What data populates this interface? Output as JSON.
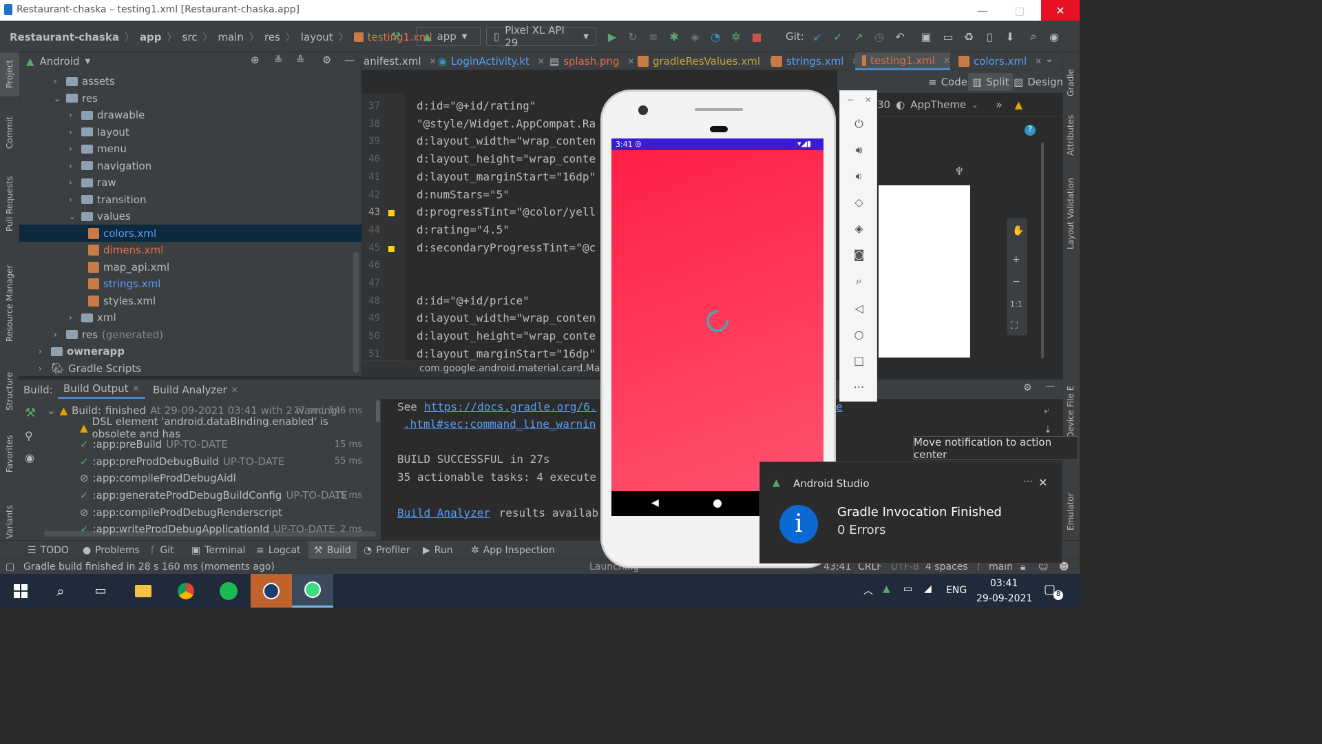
{
  "window": {
    "title": "Restaurant-chaska – testing1.xml [Restaurant-chaska.app]"
  },
  "breadcrumb": [
    "Restaurant-chaska",
    "app",
    "src",
    "main",
    "res",
    "layout",
    "testing1.xml"
  ],
  "toolbar": {
    "config": "app",
    "device": "Pixel XL API 29",
    "git_label": "Git:"
  },
  "project_panel": {
    "title": "Android",
    "items": [
      {
        "label": "assets",
        "depth": 1,
        "type": "folder",
        "expanded": false
      },
      {
        "label": "res",
        "depth": 1,
        "type": "folder",
        "expanded": true
      },
      {
        "label": "drawable",
        "depth": 2,
        "type": "folder",
        "expanded": false
      },
      {
        "label": "layout",
        "depth": 2,
        "type": "folder",
        "expanded": false
      },
      {
        "label": "menu",
        "depth": 2,
        "type": "folder",
        "expanded": false
      },
      {
        "label": "navigation",
        "depth": 2,
        "type": "folder",
        "expanded": false
      },
      {
        "label": "raw",
        "depth": 2,
        "type": "folder",
        "expanded": false
      },
      {
        "label": "transition",
        "depth": 2,
        "type": "folder",
        "expanded": false
      },
      {
        "label": "values",
        "depth": 2,
        "type": "folder",
        "expanded": true
      },
      {
        "label": "colors.xml",
        "depth": 3,
        "type": "xml",
        "selected": true
      },
      {
        "label": "dimens.xml",
        "depth": 3,
        "type": "xml"
      },
      {
        "label": "map_api.xml",
        "depth": 3,
        "type": "xml"
      },
      {
        "label": "strings.xml",
        "depth": 3,
        "type": "xml"
      },
      {
        "label": "styles.xml",
        "depth": 3,
        "type": "xml"
      },
      {
        "label": "xml",
        "depth": 2,
        "type": "folder",
        "expanded": false
      },
      {
        "label": "res",
        "suffix": "(generated)",
        "depth": 1,
        "type": "folder",
        "expanded": false
      },
      {
        "label": "ownerapp",
        "depth": 0,
        "type": "module",
        "expanded": false
      },
      {
        "label": "Gradle Scripts",
        "depth": 0,
        "type": "gradle",
        "expanded": false
      }
    ]
  },
  "editor_tabs": [
    "anifest.xml",
    "LoginActivity.kt",
    "splash.png",
    "gradleResValues.xml",
    "strings.xml",
    "testing1.xml",
    "colors.xml"
  ],
  "editor": {
    "lines": [
      {
        "n": "37",
        "text": "d:id=\"@+id/rating\""
      },
      {
        "n": "38",
        "text": "\"@style/Widget.AppCompat.Ra"
      },
      {
        "n": "39",
        "text": "d:layout_width=\"wrap_conten"
      },
      {
        "n": "40",
        "text": "d:layout_height=\"wrap_conte"
      },
      {
        "n": "41",
        "text": "d:layout_marginStart=\"16dp\""
      },
      {
        "n": "42",
        "text": "d:numStars=\"5\""
      },
      {
        "n": "43",
        "text": "d:progressTint=\"@color/yell"
      },
      {
        "n": "44",
        "text": "d:rating=\"4.5\""
      },
      {
        "n": "45",
        "text": "d:secondaryProgressTint=\"@c"
      },
      {
        "n": "46",
        "text": ""
      },
      {
        "n": "47",
        "text": ""
      },
      {
        "n": "48",
        "text": "d:id=\"@+id/price\""
      },
      {
        "n": "49",
        "text": "d:layout_width=\"wrap_conten"
      },
      {
        "n": "50",
        "text": "d:layout_height=\"wrap_conte"
      },
      {
        "n": "51",
        "text": "d:layout_marginStart=\"16dp\""
      }
    ],
    "breadcrumb": "com.google.android.material.card.Materi"
  },
  "design_bar": {
    "code": "Code",
    "split": "Split",
    "design": "Design",
    "api": "30",
    "theme": "AppTheme"
  },
  "right_tabs": [
    "Gradle",
    "Attributes",
    "Layout Validation",
    "Device File E",
    "Emulator"
  ],
  "left_tabs": [
    "Project",
    "Commit",
    "Pull Requests",
    "Resource Manager",
    "Structure",
    "Favorites",
    "Variants"
  ],
  "build": {
    "label": "Build:",
    "tabs": [
      "Build Output",
      "Build Analyzer"
    ],
    "tree": [
      {
        "icon": "warning",
        "text": "Build:",
        "bold": "finished",
        "grey": "At 29-09-2021 03:41 with 2 warning:",
        "time": "27 sec, 546 ms"
      },
      {
        "icon": "warning",
        "text": "DSL element 'android.dataBinding.enabled' is obsolete and has",
        "grey": "",
        "time": ""
      },
      {
        "icon": "check",
        "text": ":app:preBuild",
        "grey": "UP-TO-DATE",
        "time": "15 ms"
      },
      {
        "icon": "check",
        "text": ":app:preProdDebugBuild",
        "grey": "UP-TO-DATE",
        "time": "55 ms"
      },
      {
        "icon": "skip",
        "text": ":app:compileProdDebugAidl",
        "grey": "",
        "time": ""
      },
      {
        "icon": "check",
        "text": ":app:generateProdDebugBuildConfig",
        "grey": "UP-TO-DATE",
        "time": "15 ms"
      },
      {
        "icon": "skip",
        "text": ":app:compileProdDebugRenderscript",
        "grey": "",
        "time": ""
      },
      {
        "icon": "check",
        "text": ":app:writeProdDebugApplicationId",
        "grey": "UP-TO-DATE",
        "time": "2 ms"
      }
    ],
    "console": {
      "see": "See",
      "link1": "https://docs.gradle.org/6.",
      "link1_tail": "e",
      "link2": ".html#sec:command_line_warnin",
      "success": "BUILD SUCCESSFUL in 27s",
      "tasks": "35 actionable tasks: 4 execute",
      "analyzer_link": "Build Analyzer",
      "analyzer_text": " results availab"
    }
  },
  "tool_tabs": [
    "TODO",
    "Problems",
    "Git",
    "Terminal",
    "Logcat",
    "Build",
    "Profiler",
    "Run",
    "App Inspection"
  ],
  "status": {
    "message": "Gradle build finished in 28 s 160 ms (moments ago)",
    "launching": "Launching",
    "position": "43:41",
    "line_sep": "CRLF",
    "encoding": "UTF-8",
    "indent": "4 spaces",
    "branch": "main"
  },
  "phone": {
    "time": "3:41"
  },
  "tooltip": "Move notification to action center",
  "notification": {
    "app": "Android Studio",
    "title": "Gradle Invocation Finished",
    "body": "0 Errors"
  },
  "taskbar": {
    "lang": "ENG",
    "time": "03:41",
    "date": "29-09-2021",
    "badge": "8"
  },
  "colors": {
    "accent": "#589df6",
    "selection": "#0d293e",
    "phone_bg": "#ff2d50",
    "status_bar": "#3a1bd6"
  }
}
